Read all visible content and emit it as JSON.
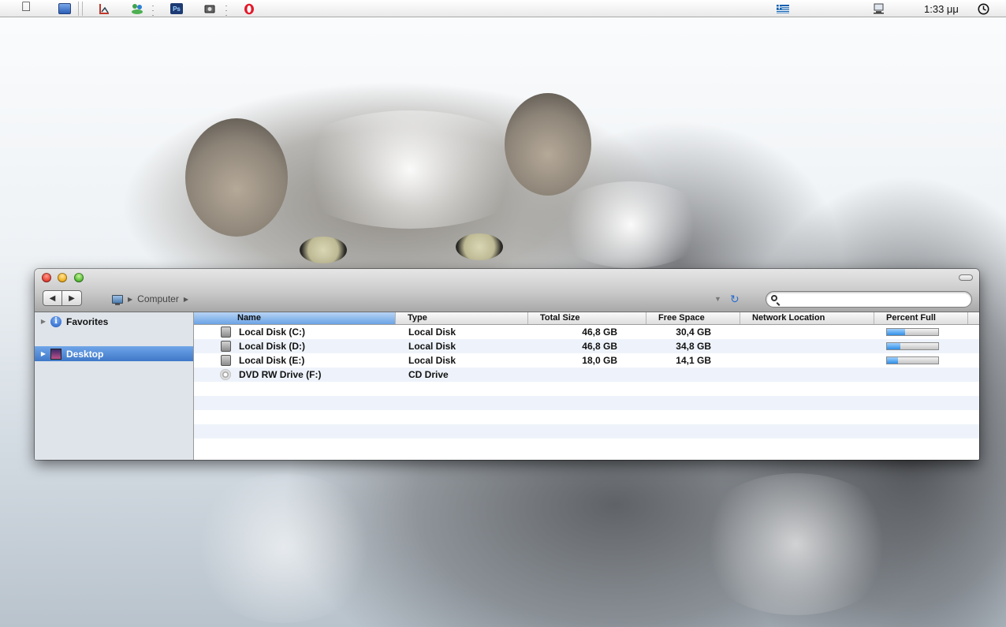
{
  "menubar": {
    "clock": "1:33 μμ",
    "icons": [
      "apple-icon",
      "finder-icon",
      "chart-icon",
      "messenger-icon",
      "photoshop-icon",
      "camera-icon",
      "opera-icon",
      "flag-icon",
      "network-icon",
      "time-machine-icon"
    ],
    "photoshop_label": "Ps"
  },
  "window": {
    "path": {
      "location": "Computer"
    },
    "search": {
      "placeholder": "",
      "value": ""
    },
    "sidebar": [
      {
        "label": "Favorites",
        "selected": false
      },
      {
        "label": "Desktop",
        "selected": true
      }
    ],
    "columns": {
      "name": "Name",
      "type": "Type",
      "total_size": "Total Size",
      "free_space": "Free Space",
      "network_location": "Network Location",
      "percent_full": "Percent Full"
    },
    "drives": [
      {
        "name": "Local Disk (C:)",
        "type": "Local Disk",
        "total": "46,8 GB",
        "free": "30,4 GB",
        "network": "",
        "percent_full": 35
      },
      {
        "name": "Local Disk (D:)",
        "type": "Local Disk",
        "total": "46,8 GB",
        "free": "34,8 GB",
        "network": "",
        "percent_full": 26
      },
      {
        "name": "Local Disk (E:)",
        "type": "Local Disk",
        "total": "18,0 GB",
        "free": "14,1 GB",
        "network": "",
        "percent_full": 22
      },
      {
        "name": "DVD RW Drive (F:)",
        "type": "CD Drive",
        "total": "",
        "free": "",
        "network": "",
        "percent_full": null
      }
    ]
  },
  "colors": {
    "accent": "#3f78c8",
    "row_alt": "#eef3fb",
    "progress": "#2f8fe6"
  }
}
